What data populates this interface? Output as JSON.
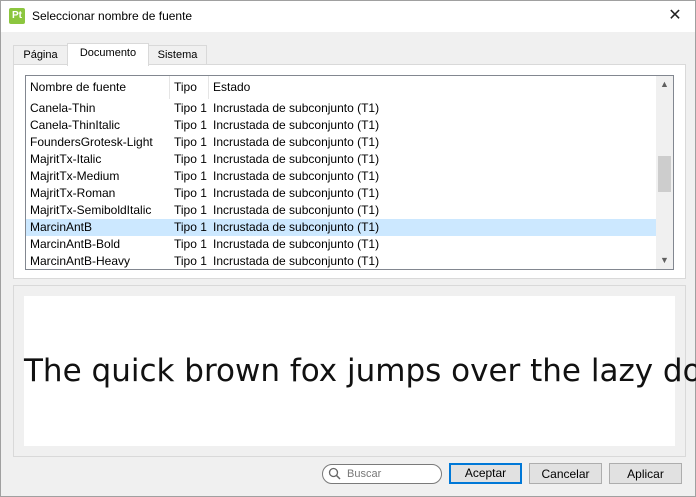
{
  "window": {
    "title": "Seleccionar nombre de fuente",
    "app_icon": "Pt",
    "close_glyph": "✕"
  },
  "tabs": [
    {
      "label": "Página",
      "active": false
    },
    {
      "label": "Documento",
      "active": true
    },
    {
      "label": "Sistema",
      "active": false
    }
  ],
  "font_list": {
    "columns": [
      "Nombre de fuente",
      "Tipo",
      "Estado"
    ],
    "rows": [
      {
        "name": "Canela-Thin",
        "type": "Tipo 1",
        "status": "Incrustada de subconjunto (T1)",
        "selected": false
      },
      {
        "name": "Canela-ThinItalic",
        "type": "Tipo 1",
        "status": "Incrustada de subconjunto (T1)",
        "selected": false
      },
      {
        "name": "FoundersGrotesk-Light",
        "type": "Tipo 1",
        "status": "Incrustada de subconjunto (T1)",
        "selected": false
      },
      {
        "name": "MajritTx-Italic",
        "type": "Tipo 1",
        "status": "Incrustada de subconjunto (T1)",
        "selected": false
      },
      {
        "name": "MajritTx-Medium",
        "type": "Tipo 1",
        "status": "Incrustada de subconjunto (T1)",
        "selected": false
      },
      {
        "name": "MajritTx-Roman",
        "type": "Tipo 1",
        "status": "Incrustada de subconjunto (T1)",
        "selected": false
      },
      {
        "name": "MajritTx-SemiboldItalic",
        "type": "Tipo 1",
        "status": "Incrustada de subconjunto (T1)",
        "selected": false
      },
      {
        "name": "MarcinAntB",
        "type": "Tipo 1",
        "status": "Incrustada de subconjunto (T1)",
        "selected": true
      },
      {
        "name": "MarcinAntB-Bold",
        "type": "Tipo 1",
        "status": "Incrustada de subconjunto (T1)",
        "selected": false
      },
      {
        "name": "MarcinAntB-Heavy",
        "type": "Tipo 1",
        "status": "Incrustada de subconjunto (T1)",
        "selected": false
      }
    ],
    "scroll_up_glyph": "▲",
    "scroll_down_glyph": "▼"
  },
  "preview": {
    "text": "The quick brown fox jumps over the lazy dog"
  },
  "search": {
    "placeholder": "Buscar",
    "icon": "search-icon",
    "value": ""
  },
  "buttons": {
    "accept": "Aceptar",
    "cancel": "Cancelar",
    "apply": "Aplicar"
  },
  "colors": {
    "selection": "#cce8ff",
    "primary_border": "#0078d7",
    "app_icon": "#8cc63f"
  }
}
